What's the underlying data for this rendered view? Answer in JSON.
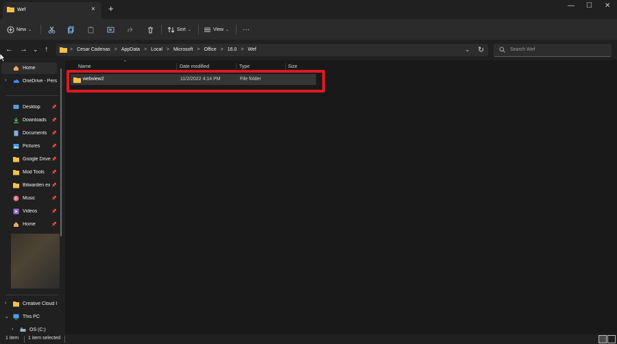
{
  "window": {
    "tab_title": "Wef",
    "tab_close_icon": "×",
    "new_tab_icon": "+",
    "minimize_icon": "—",
    "maximize_icon": "☐",
    "close_icon": "✕"
  },
  "toolbar": {
    "new_label": "New",
    "sort_label": "Sort",
    "view_label": "View",
    "more_icon": "···",
    "caret": "⌄"
  },
  "address": {
    "back_icon": "←",
    "forward_icon": "→",
    "recent_icon": "⌄",
    "up_icon": "↑",
    "separator": ">",
    "crumbs": [
      "Cesar Cadenas",
      "AppData",
      "Local",
      "Microsoft",
      "Office",
      "16.0",
      "Wef"
    ],
    "dropdown_icon": "⌄",
    "refresh_icon": "↻",
    "search_placeholder": "Search Wef"
  },
  "sidebar": {
    "items": [
      {
        "label": "Home"
      },
      {
        "label": "OneDrive - Pers"
      },
      {
        "label": "Desktop",
        "pinned": true
      },
      {
        "label": "Downloads",
        "pinned": true
      },
      {
        "label": "Documents",
        "pinned": true
      },
      {
        "label": "Pictures",
        "pinned": true
      },
      {
        "label": "Google Drive",
        "pinned": true
      },
      {
        "label": "Mod Tools",
        "pinned": true
      },
      {
        "label": "Bitwarden ex",
        "pinned": true
      },
      {
        "label": "Music",
        "pinned": true
      },
      {
        "label": "Videos",
        "pinned": true
      },
      {
        "label": "Home",
        "pinned": true
      },
      {
        "label": "Creative Cloud I"
      },
      {
        "label": "This PC"
      },
      {
        "label": "OS (C:)"
      }
    ],
    "pin_icon": "📌",
    "expand_icon": "›",
    "expanded_icon": "⌄"
  },
  "columns": [
    "Name",
    "Date modified",
    "Type",
    "Size"
  ],
  "sort_caret": "^",
  "files": [
    {
      "name": "webview2",
      "date": "11/2/2022 4:14 PM",
      "type": "File folder",
      "size": ""
    }
  ],
  "status": {
    "count": "1 item",
    "selected": "1 item selected"
  },
  "colors": {
    "highlight": "#e0191f",
    "folder": "#f3c247"
  }
}
